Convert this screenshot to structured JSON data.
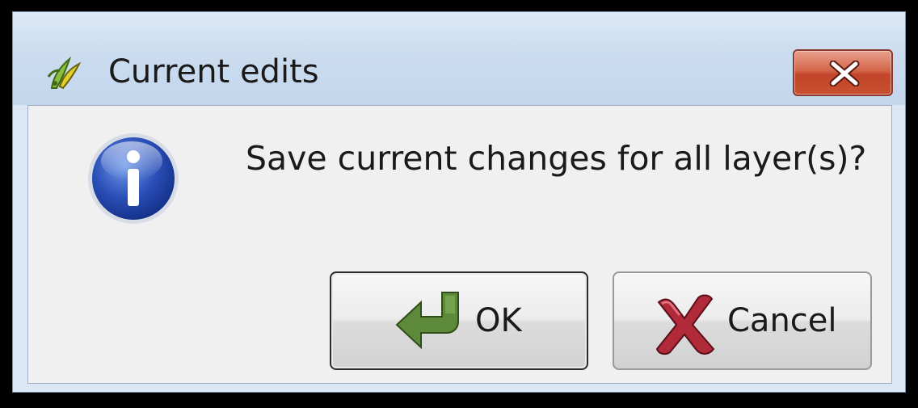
{
  "window": {
    "title": "Current edits",
    "app_icon": "qgis-logo-icon",
    "close_icon": "close-icon"
  },
  "dialog": {
    "icon": "info-icon",
    "message": "Save current changes for all layer(s)?"
  },
  "buttons": {
    "ok": {
      "label": "OK",
      "icon": "ok-arrow-icon"
    },
    "cancel": {
      "label": "Cancel",
      "icon": "cancel-x-icon"
    }
  },
  "colors": {
    "titlebar": "#cbdcef",
    "client_background": "#f0f0f0",
    "close_button": "#c8512f",
    "info_icon_blue": "#2a4fb8",
    "ok_icon_green": "#5c8a3a",
    "cancel_icon_red": "#b02a3a"
  }
}
